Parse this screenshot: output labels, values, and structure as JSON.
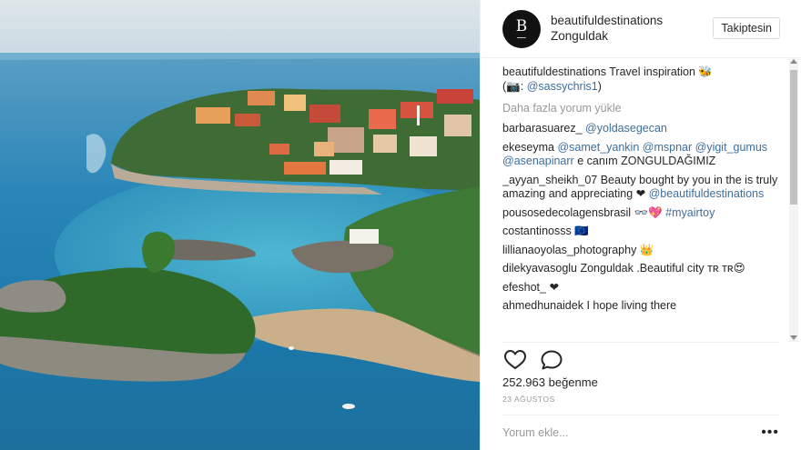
{
  "header": {
    "avatar_letter": "B",
    "username": "beautifuldestinations",
    "location": "Zonguldak",
    "follow_label": "Takiptesin"
  },
  "caption": {
    "user": "beautifuldestinations",
    "text": " Travel inspiration 🐝",
    "credit_prefix": "(📷: ",
    "credit_mention": "@sassychris1",
    "credit_suffix": ")"
  },
  "load_more_label": "Daha fazla yorum yükle",
  "comments": [
    {
      "user": "barbarasuarez_",
      "parts": [
        {
          "t": " "
        },
        {
          "m": "@yoldasegecan"
        }
      ]
    },
    {
      "user": "ekeseyma",
      "parts": [
        {
          "t": " "
        },
        {
          "m": "@samet_yankin"
        },
        {
          "t": " "
        },
        {
          "m": "@mspnar"
        },
        {
          "t": " "
        },
        {
          "m": "@yigit_gumus"
        },
        {
          "t": " "
        },
        {
          "m": "@asenapinarr"
        },
        {
          "t": " e canım ZONGULDAĞIMIZ"
        }
      ]
    },
    {
      "user": "_ayyan_sheikh_07",
      "parts": [
        {
          "t": " Beauty bought by you in the is truly amazing and appreciating ❤ "
        },
        {
          "m": "@beautifuldestinations"
        }
      ]
    },
    {
      "user": "pousosedecolagensbrasil",
      "parts": [
        {
          "t": " 👓💖 "
        },
        {
          "m": "#myairtoy"
        }
      ]
    },
    {
      "user": "costantinosss",
      "parts": [
        {
          "t": " 🇪🇺"
        }
      ]
    },
    {
      "user": "lillianaoyolas_photography",
      "parts": [
        {
          "t": " 👑"
        }
      ]
    },
    {
      "user": "dilekyavasoglu",
      "parts": [
        {
          "t": " Zonguldak .Beautiful city ᴛʀ ᴛʀ😍"
        }
      ]
    },
    {
      "user": "efeshot_",
      "parts": [
        {
          "t": " ❤"
        }
      ]
    },
    {
      "user": "ahmedhunaidek",
      "parts": [
        {
          "t": " I hope living there"
        }
      ]
    }
  ],
  "actions": {
    "like_icon": "heart-icon",
    "comment_icon": "speech-bubble-icon"
  },
  "likes_label": "252.963 beğenme",
  "date_label": "23 AĞUSTOS",
  "add_comment": {
    "placeholder": "Yorum ekle...",
    "more_label": "•••"
  },
  "colors": {
    "mention": "#3e6e9c",
    "muted": "#999999",
    "text": "#262626",
    "border": "#efefef"
  }
}
